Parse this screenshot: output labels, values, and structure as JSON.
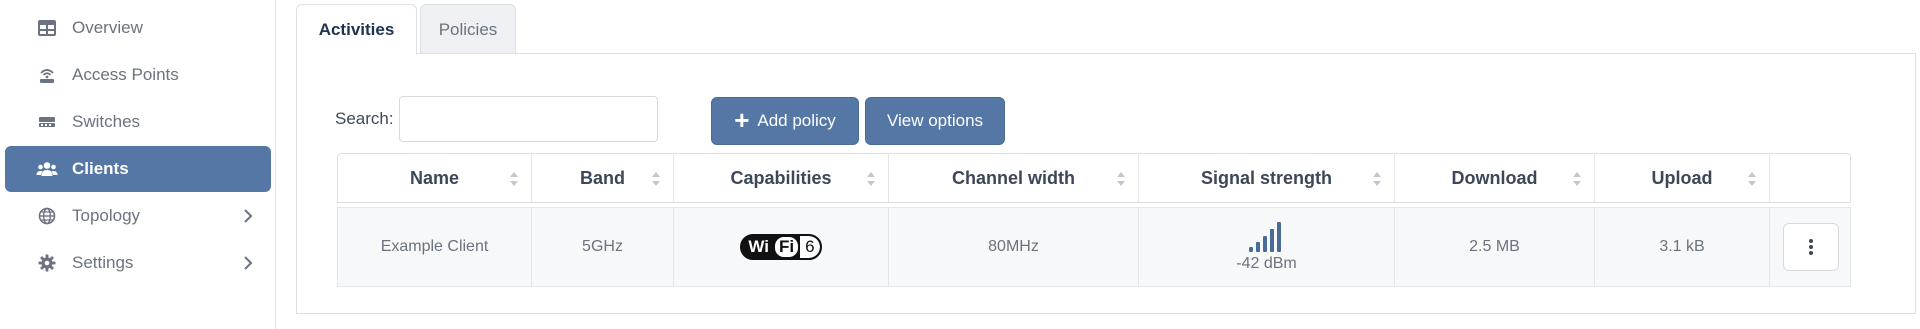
{
  "sidebar": {
    "items": [
      {
        "label": "Overview",
        "icon": "table-grid-icon",
        "active": false
      },
      {
        "label": "Access Points",
        "icon": "access-point-icon",
        "active": false
      },
      {
        "label": "Switches",
        "icon": "switch-icon",
        "active": false
      },
      {
        "label": "Clients",
        "icon": "users-icon",
        "active": true
      },
      {
        "label": "Topology",
        "icon": "globe-icon",
        "active": false,
        "expandable": true
      },
      {
        "label": "Settings",
        "icon": "gear-icon",
        "active": false,
        "expandable": true
      }
    ]
  },
  "tabs": [
    {
      "label": "Activities",
      "active": true
    },
    {
      "label": "Policies",
      "active": false
    }
  ],
  "toolbar": {
    "search_label": "Search:",
    "search_value": "",
    "add_policy_label": "Add policy",
    "view_options_label": "View options"
  },
  "table": {
    "columns": [
      "Name",
      "Band",
      "Capabilities",
      "Channel width",
      "Signal strength",
      "Download",
      "Upload",
      ""
    ],
    "rows": [
      {
        "name": "Example Client",
        "band": "5GHz",
        "capabilities": {
          "wifi_text_a": "Wi",
          "wifi_text_b": "Fi",
          "generation": "6"
        },
        "channel_width": "80MHz",
        "signal": "-42 dBm",
        "download": "2.5 MB",
        "upload": "3.1 kB"
      }
    ]
  },
  "colors": {
    "accent": "#5577a6",
    "signal_bars": "#4a6a97"
  }
}
